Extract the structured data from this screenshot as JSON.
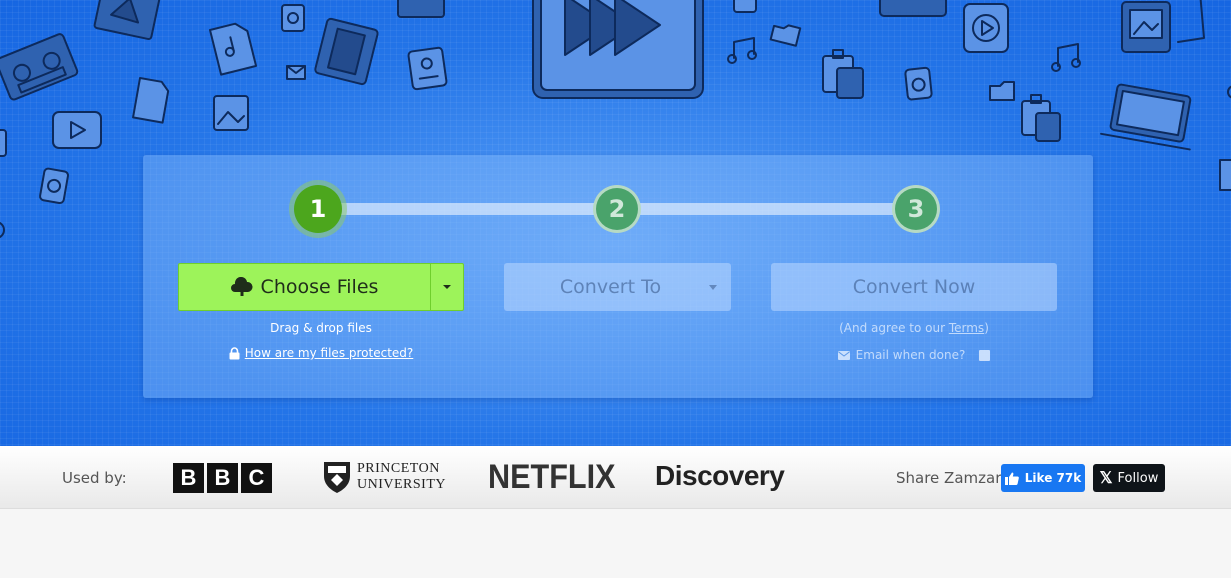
{
  "steps": [
    "1",
    "2",
    "3"
  ],
  "actions": {
    "choose_files": "Choose Files",
    "convert_to": "Convert To",
    "convert_now": "Convert Now"
  },
  "upload_help": {
    "drag_drop": "Drag & drop files",
    "protected_link": "How are my files protected?"
  },
  "terms": {
    "prefix": "(And agree to our ",
    "link": "Terms",
    "suffix": ")",
    "email_label": "Email when done?"
  },
  "used_by": {
    "label": "Used by:",
    "logos": {
      "bbc": [
        "B",
        "B",
        "C"
      ],
      "princeton_line1": "PRINCETON",
      "princeton_line2": "UNIVERSITY",
      "netflix": "NETFLIX",
      "discovery": "Discovery"
    }
  },
  "share": {
    "label": "Share Zamzar:",
    "like": "Like 77k",
    "follow": "Follow"
  },
  "colors": {
    "hero_blue": "#2475e8",
    "step_active": "#4ca61d",
    "choose_button": "#9df35a",
    "facebook": "#1877f2",
    "x_black": "#0f1419"
  }
}
